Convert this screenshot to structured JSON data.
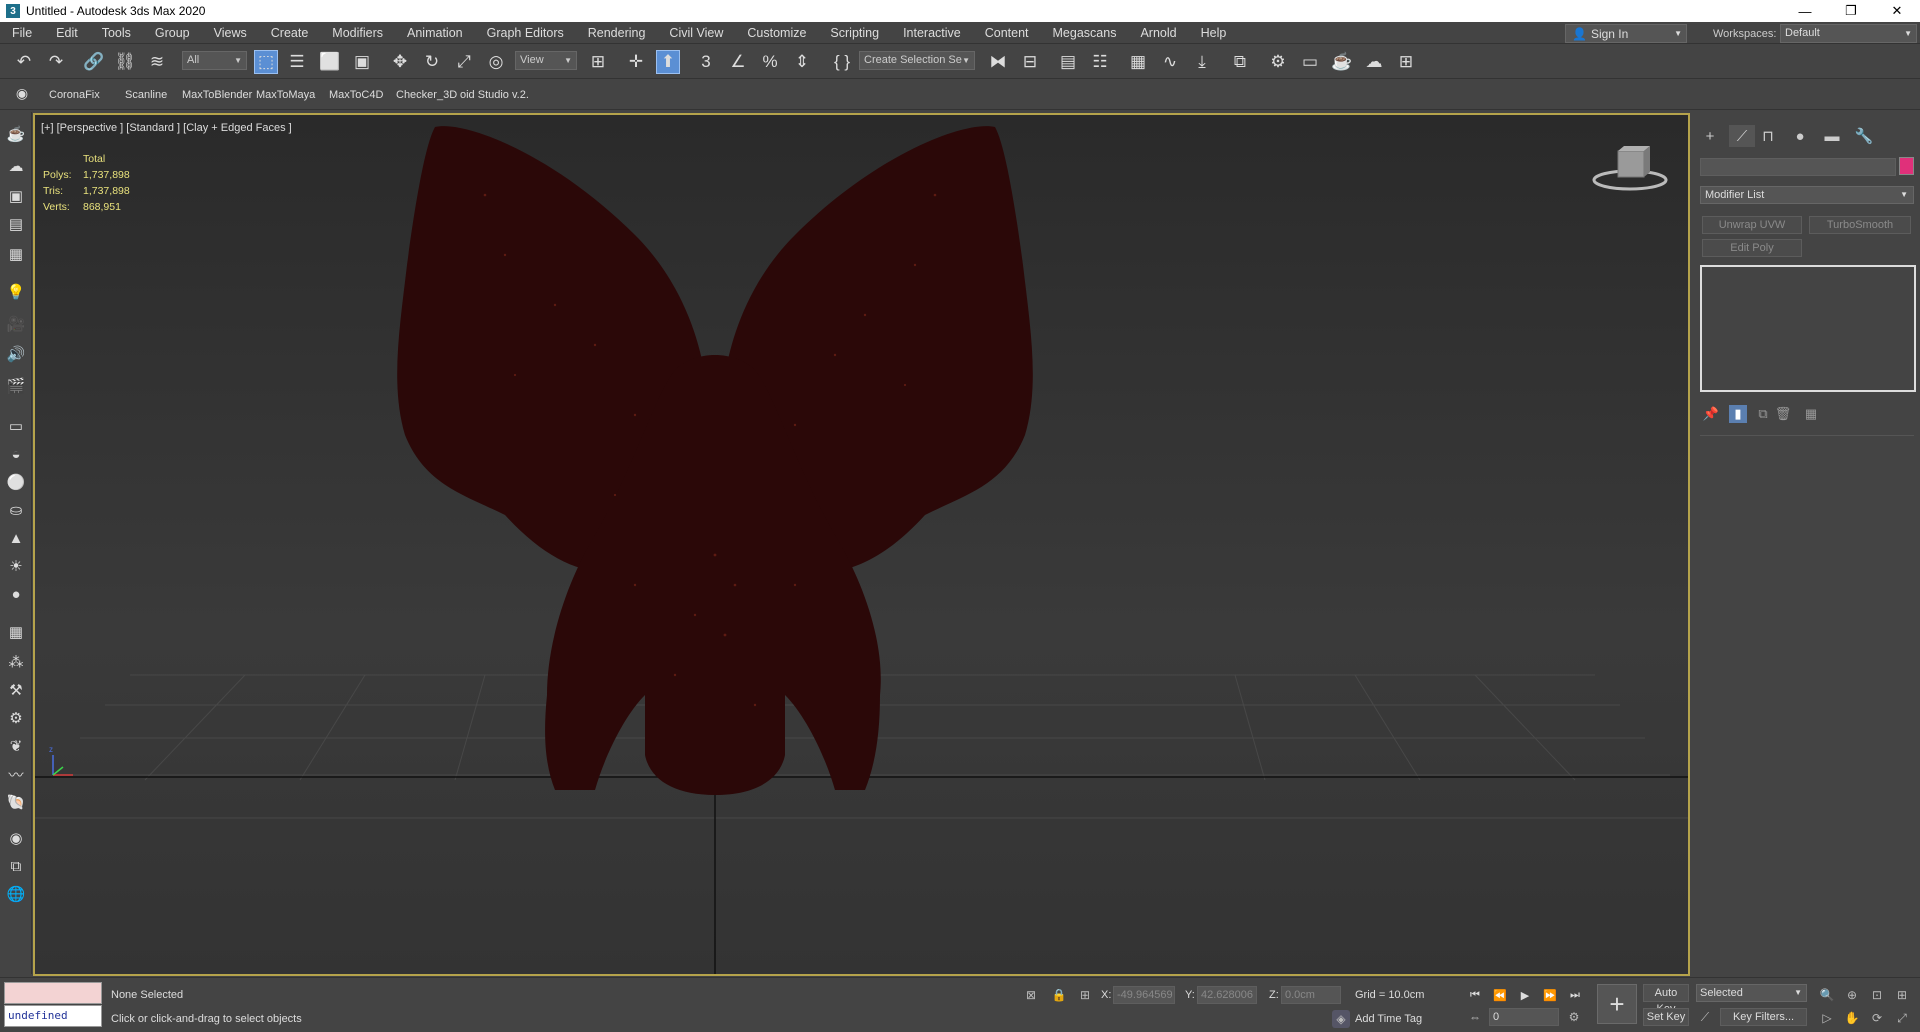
{
  "window": {
    "title": "Untitled - Autodesk 3ds Max 2020",
    "minimize": "—",
    "restore": "❐",
    "close": "✕"
  },
  "menu": [
    "File",
    "Edit",
    "Tools",
    "Group",
    "Views",
    "Create",
    "Modifiers",
    "Animation",
    "Graph Editors",
    "Rendering",
    "Civil View",
    "Customize",
    "Scripting",
    "Interactive",
    "Content",
    "Megascans",
    "Arnold",
    "Help"
  ],
  "account": {
    "signin": "Sign In",
    "workspaces_label": "Workspaces:",
    "workspace": "Default"
  },
  "toolbar": {
    "selection_filter": "All",
    "ref_coord": "View",
    "named_selection": "Create Selection Se"
  },
  "toolbar2": [
    "CoronaFix",
    "Scanline",
    "MaxToBlender",
    "MaxToMaya",
    "MaxToC4D",
    "Checker_3D",
    "oid Studio v.2."
  ],
  "viewport": {
    "label": "[+] [Perspective ] [Standard ] [Clay + Edged Faces ]",
    "stats": {
      "header": "Total",
      "rows": [
        {
          "k": "Polys:",
          "v": "1,737,898"
        },
        {
          "k": "Tris:",
          "v": "1,737,898"
        },
        {
          "k": "Verts:",
          "v": "868,951"
        }
      ]
    },
    "object_color": "#2b0808",
    "selection_border": "#b5a34b"
  },
  "command_panel": {
    "modifier_list": "Modifier List",
    "buttons": [
      "Unwrap UVW",
      "TurboSmooth",
      "Edit Poly"
    ],
    "object_color": "#e0307a"
  },
  "status": {
    "maxscript_output": "undefined",
    "selection": "None Selected",
    "prompt": "Click or click-and-drag to select objects",
    "x_label": "X:",
    "x_value": "-49.964569",
    "y_label": "Y:",
    "y_value": "42.628006",
    "z_label": "Z:",
    "z_value": "0.0cm",
    "grid": "Grid = 10.0cm",
    "add_time_tag": "Add Time Tag",
    "frame": "0",
    "auto_key": "Auto Key",
    "set_key": "Set Key",
    "key_mode": "Selected",
    "key_filters": "Key Filters..."
  }
}
